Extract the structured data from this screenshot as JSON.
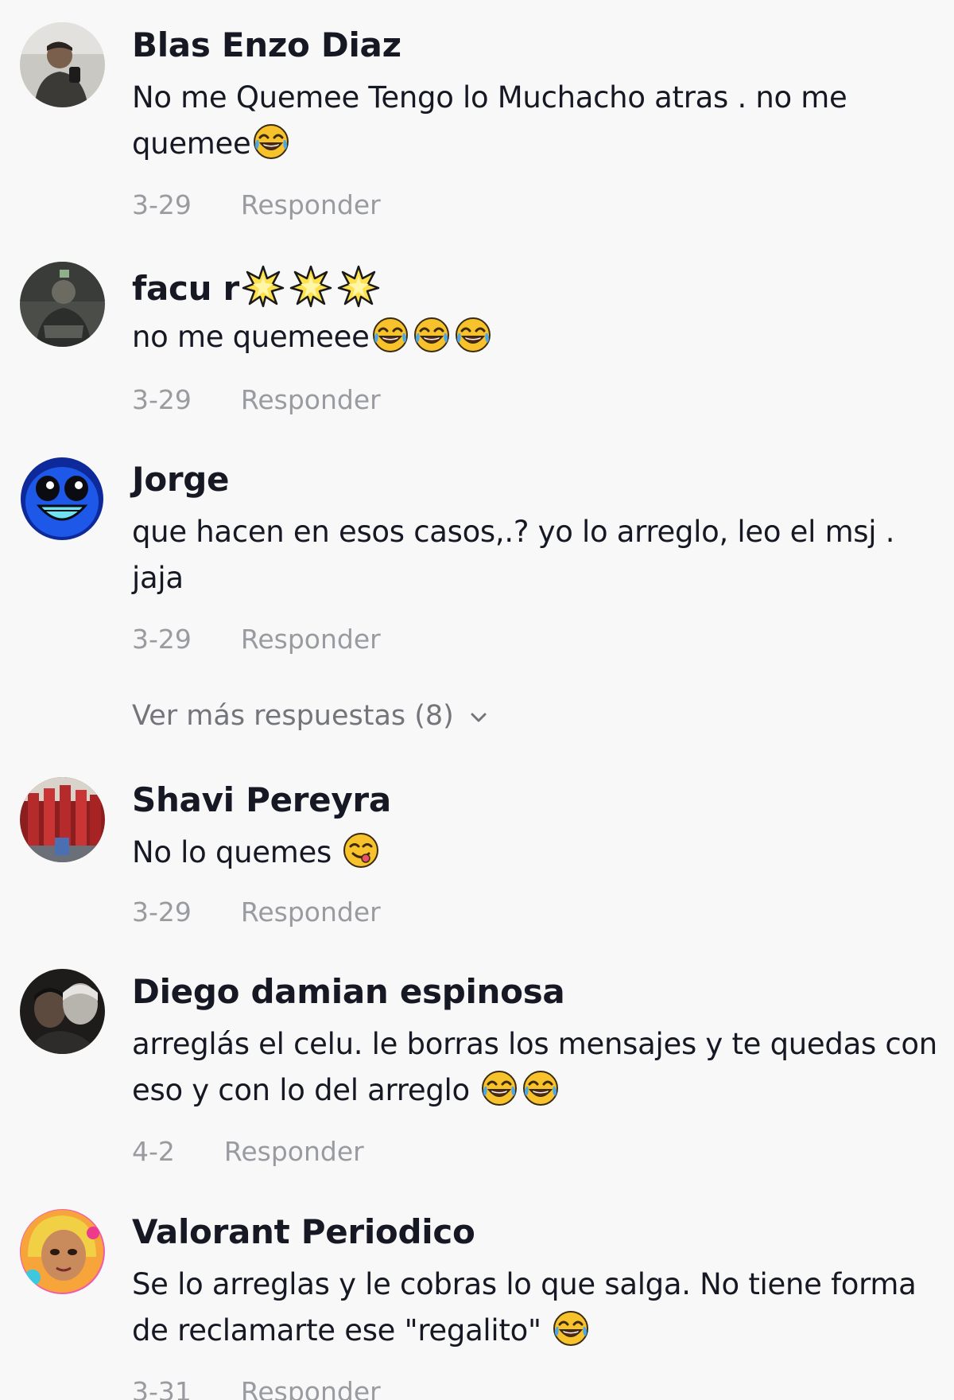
{
  "comments": [
    {
      "author": "Blas Enzo Diaz",
      "text": "No me Quemee Tengo lo Muchacho atras . no me quemee",
      "emojis": [
        "face-with-tears-of-joy"
      ],
      "date": "3-29",
      "reply_label": "Responder"
    },
    {
      "author": "facu r",
      "author_emojis": [
        "glowing-star",
        "glowing-star",
        "glowing-star"
      ],
      "text": "no me quemeee",
      "emojis": [
        "face-with-tears-of-joy",
        "face-with-tears-of-joy",
        "face-with-tears-of-joy"
      ],
      "date": "3-29",
      "reply_label": "Responder"
    },
    {
      "author": "Jorge",
      "text": "que hacen en esos casos,.? yo lo arreglo, leo el msj . jaja",
      "date": "3-29",
      "reply_label": "Responder"
    },
    {
      "author": "Shavi Pereyra",
      "text": "No lo quemes",
      "emojis": [
        "face-savoring-food"
      ],
      "date": "3-29",
      "reply_label": "Responder"
    },
    {
      "author": "Diego damian espinosa",
      "text": "arreglás el celu. le borras los mensajes y te quedas con eso y con lo del arreglo",
      "emojis": [
        "face-with-tears-of-joy",
        "face-with-tears-of-joy"
      ],
      "date": "4-2",
      "reply_label": "Responder"
    },
    {
      "author": "Valorant Periodico",
      "text": "Se lo arreglas y le cobras lo que salga. No tiene forma de reclamarte ese \"regalito\"",
      "emojis": [
        "face-with-tears-of-joy"
      ],
      "date": "3-31",
      "reply_label": "Responder"
    }
  ],
  "more_replies": {
    "label": "Ver más respuestas (8)",
    "icon": "chevron-down-icon"
  },
  "colors": {
    "background": "#f8f8f8",
    "author": "#161823",
    "text": "#161823",
    "meta": "#9a9ba0",
    "more_replies": "#74757b"
  }
}
